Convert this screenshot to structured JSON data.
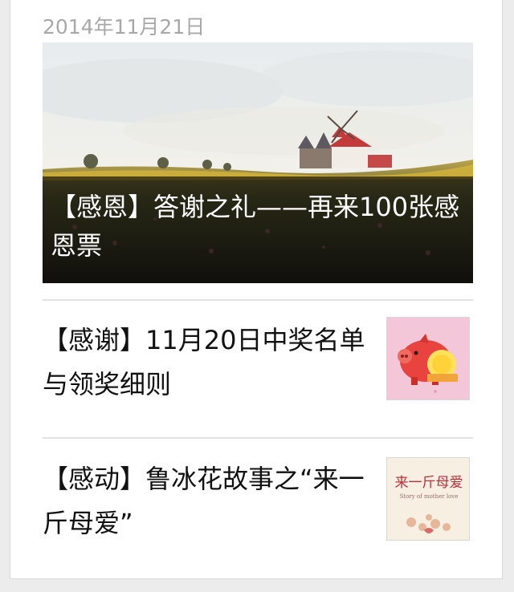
{
  "date": "2014年11月21日",
  "articles": [
    {
      "title": "【感恩】答谢之礼——再来100张感恩票",
      "image": "windmill-field-photo"
    },
    {
      "title": "【感谢】11月20日中奖名单与领奖细则",
      "image": "piggy-bank-icon"
    },
    {
      "title": "【感动】鲁冰花故事之“来一斤母爱”",
      "image": "mother-love-cover"
    }
  ],
  "thumb_text": {
    "mother_love_title": "来一斤母爱",
    "mother_love_sub": "Story of mother love"
  },
  "colors": {
    "date_text": "#a8a8a8",
    "title_text": "#111111",
    "overlay": "#000000",
    "thumb_pink": "#f3c6d8",
    "piggy_red": "#e8433f"
  }
}
